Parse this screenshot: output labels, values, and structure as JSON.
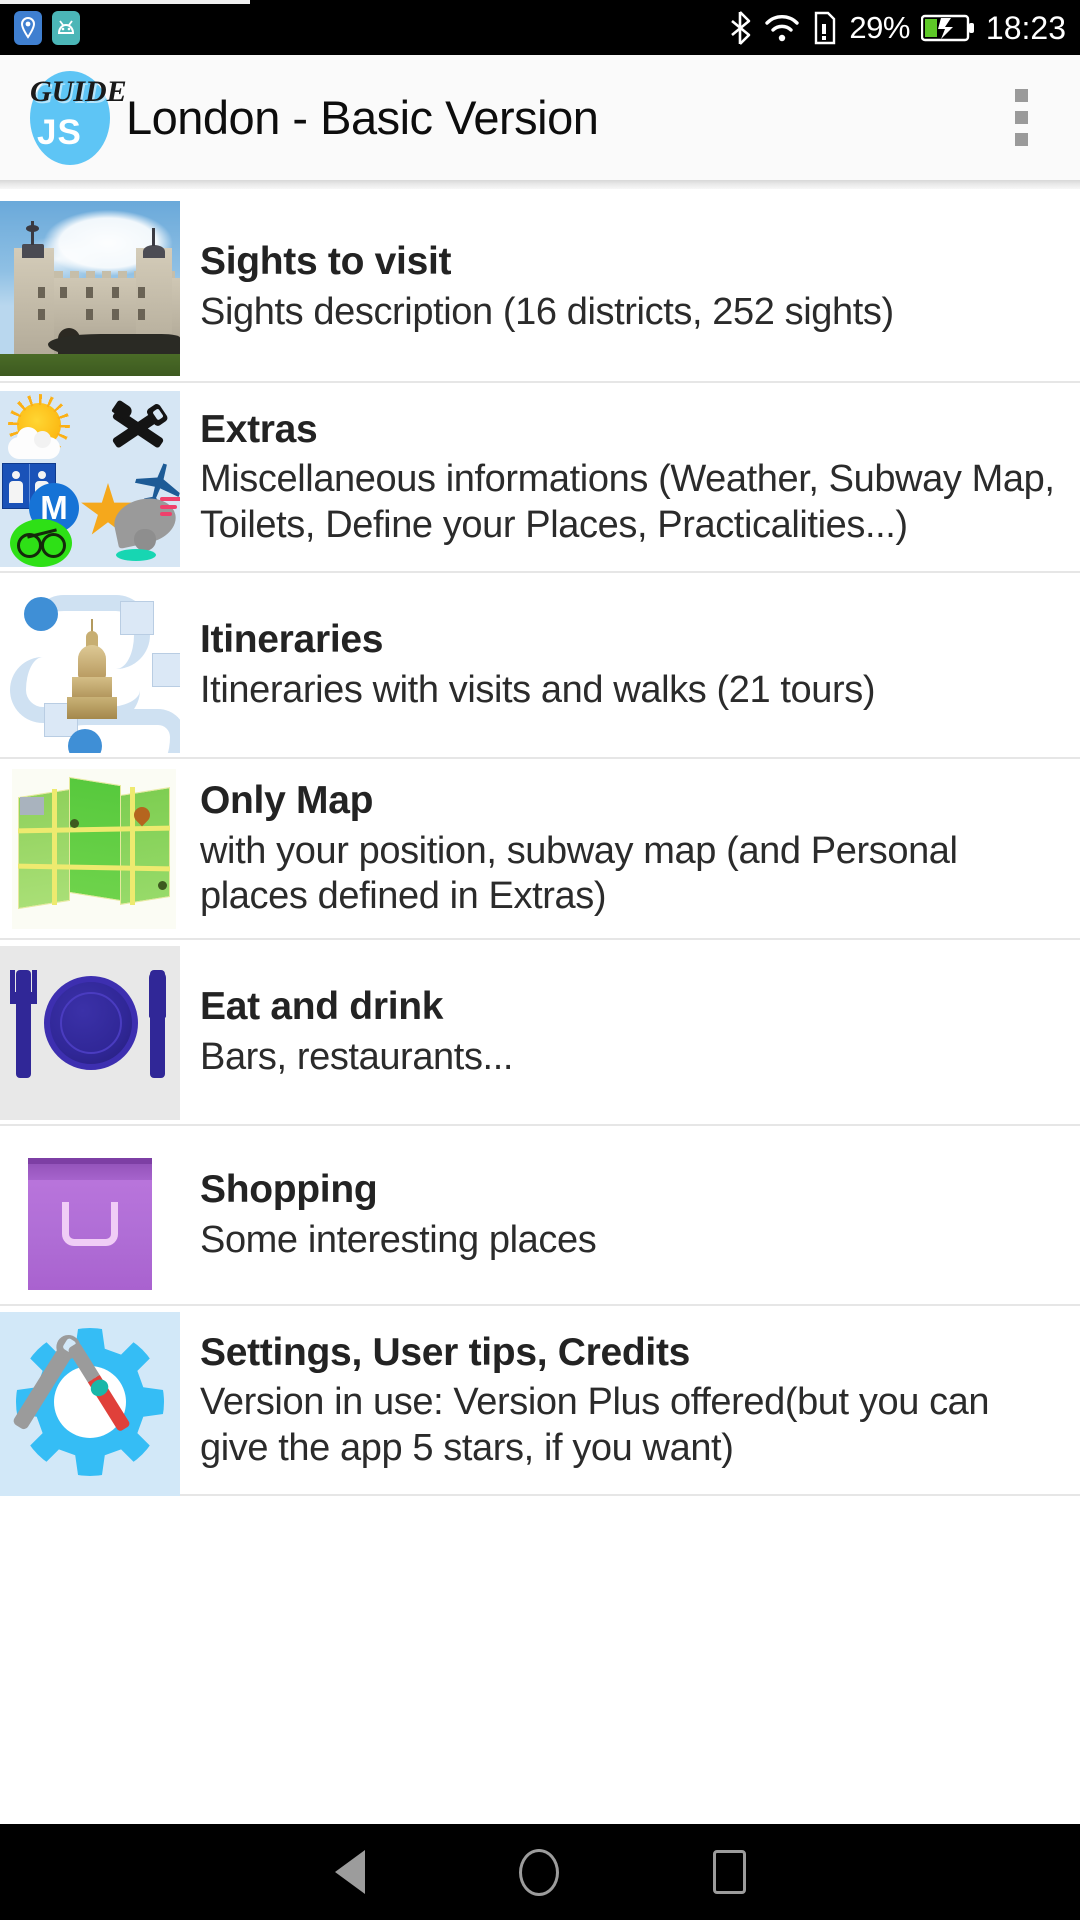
{
  "status_bar": {
    "icons_left": [
      "location-pin-icon",
      "android-app-icon"
    ],
    "icons_right": [
      "bluetooth-icon",
      "wifi-icon",
      "sim-card-alert-icon",
      "battery-charging-icon"
    ],
    "battery_percent": "29%",
    "clock": "18:23"
  },
  "app_bar": {
    "logo_top_text": "GUIDE",
    "logo_bottom_text": "JS",
    "logo_color": "#5ec5f5",
    "title": "London - Basic Version",
    "overflow_icon": "more-vert-icon"
  },
  "list": {
    "items": [
      {
        "title": "Sights to visit",
        "subtitle": "Sights description (16 districts, 252 sights)",
        "thumb_icon": "tower-of-london-photo"
      },
      {
        "title": "Extras",
        "subtitle": "Miscellaneous informations (Weather, Subway Map, Toilets, Define your Places, Practicalities...)",
        "thumb_icon": "extras-collage-icon"
      },
      {
        "title": "Itineraries",
        "subtitle": "Itineraries with visits and walks (21 tours)",
        "thumb_icon": "route-with-monument-icon"
      },
      {
        "title": "Only Map",
        "subtitle": "with your position, subway map (and Personal places defined in Extras)",
        "thumb_icon": "folded-map-icon"
      },
      {
        "title": "Eat and drink",
        "subtitle": "Bars, restaurants...",
        "thumb_icon": "cutlery-plate-icon"
      },
      {
        "title": "Shopping",
        "subtitle": "Some interesting places",
        "thumb_icon": "shopping-bag-icon"
      },
      {
        "title": "Settings, User tips, Credits",
        "subtitle": "Version in use: Version Plus offered(but you can give the app 5 stars, if you want)",
        "thumb_icon": "gear-tools-icon"
      }
    ]
  },
  "nav_bar": {
    "back": "back-icon",
    "home": "home-icon",
    "recents": "recents-icon"
  },
  "colors": {
    "status_bar_bg": "#000000",
    "app_bar_bg": "#fafafa",
    "accent": "#5ec5f5",
    "title_text": "#232323",
    "subtitle_text": "#2b2b2b",
    "divider": "#e6e6e6",
    "nav_bar_bg": "#000000",
    "nav_icon": "#9c9c9c"
  }
}
